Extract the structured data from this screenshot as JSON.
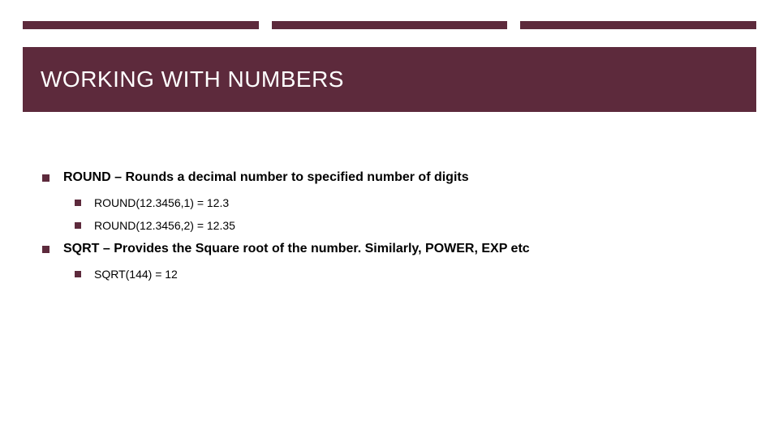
{
  "title": "WORKING WITH NUMBERS",
  "bullets": [
    {
      "strong": "ROUND",
      "rest": " – Rounds a decimal number to specified number of digits",
      "sub": [
        "ROUND(12.3456,1) = 12.3",
        "ROUND(12.3456,2) = 12.35"
      ]
    },
    {
      "strong": "SQRT",
      "rest": " – Provides the Square root of the number. Similarly, POWER, EXP etc",
      "sub": [
        "SQRT(144) = 12"
      ]
    }
  ]
}
